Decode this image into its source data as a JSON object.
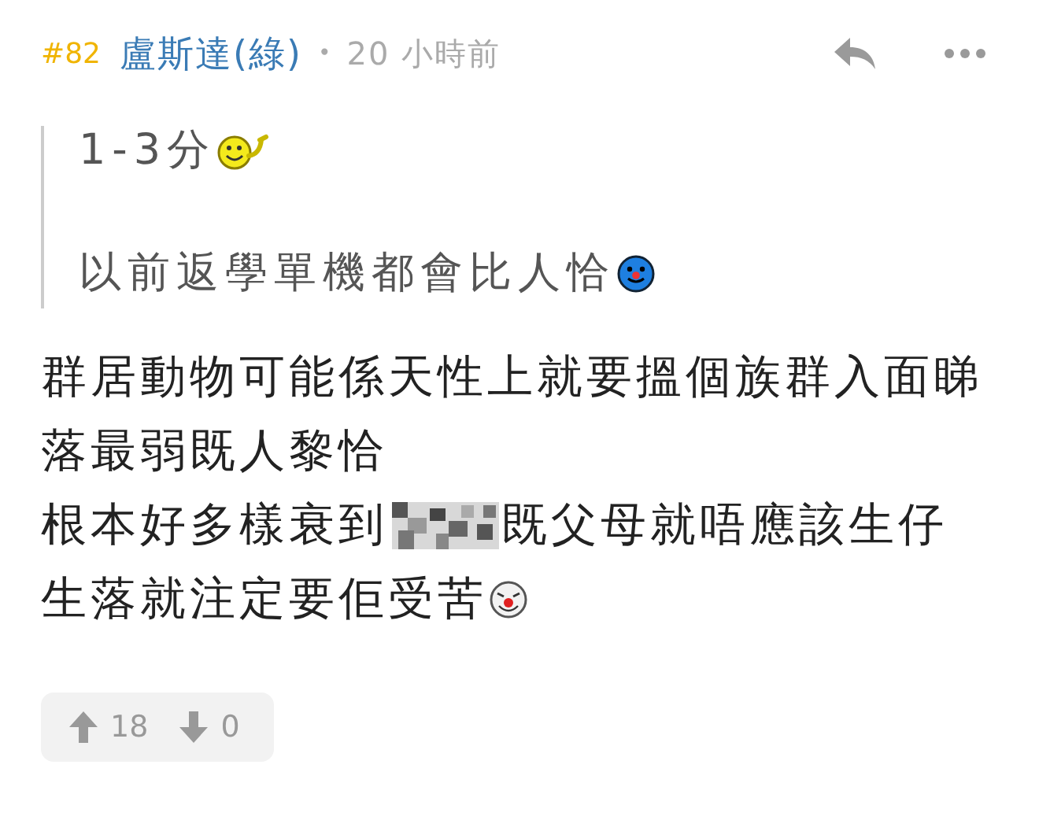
{
  "post": {
    "number": "#82",
    "author": "盧斯達(綠)",
    "separator": "•",
    "time": "20 小時前"
  },
  "quote": [
    [
      {
        "kind": "text",
        "text": "1-3分"
      },
      {
        "kind": "smile-wave"
      }
    ],
    [
      {
        "kind": "text",
        "text": "以前返學單機都會比人恰"
      },
      {
        "kind": "round-face"
      }
    ]
  ],
  "body": [
    [
      {
        "kind": "text",
        "text": "群居動物可能係天性上就要搵個族群入面睇"
      }
    ],
    [
      {
        "kind": "text",
        "text": "落最弱既人黎恰"
      }
    ],
    [
      {
        "kind": "text",
        "text": "根本好多樣衰到"
      },
      {
        "kind": "picture"
      },
      {
        "kind": "text",
        "text": "既父母就唔應該生仔"
      }
    ],
    [
      {
        "kind": "text",
        "text": "生落就注定要佢受苦"
      },
      {
        "kind": "clown"
      }
    ]
  ],
  "votes": {
    "up": "18",
    "down": "0"
  }
}
